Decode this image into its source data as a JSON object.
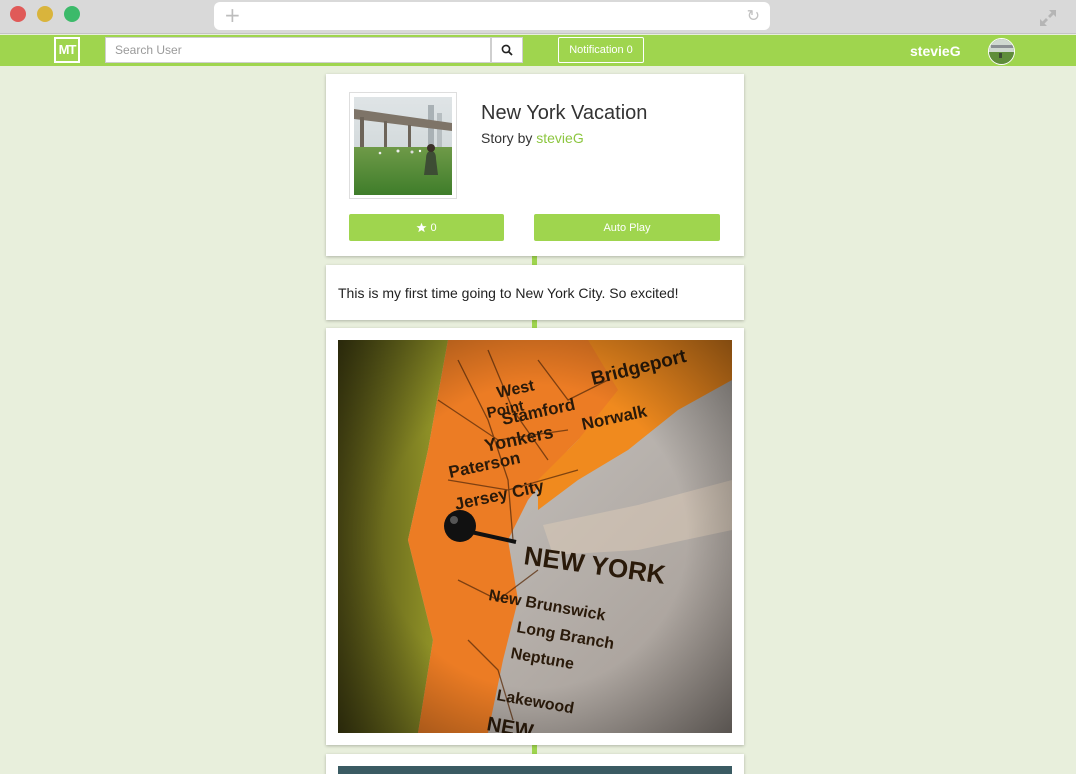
{
  "browser": {
    "window_controls": [
      "close",
      "minimize",
      "zoom"
    ],
    "new_tab_icon": "plus-icon",
    "reload_icon": "reload-icon",
    "fullscreen_icon": "expand-icon"
  },
  "navbar": {
    "logo_text": "MT",
    "search_placeholder": "Search User",
    "search_icon": "search-icon",
    "notification_label": "Notification 0",
    "username": "stevieG"
  },
  "story": {
    "title": "New York Vacation",
    "by_label": "Story by",
    "author": "stevieG",
    "star_count": "0",
    "star_icon": "star-icon",
    "autoplay_label": "Auto Play"
  },
  "entries": [
    {
      "type": "text",
      "text": "This is my first time going to New York City. So excited!"
    },
    {
      "type": "image",
      "map_labels": [
        "Stamford",
        "Norwalk",
        "Bridgeport",
        "Yonkers",
        "Paterson",
        "Jersey City",
        "NEW YORK",
        "New Brunswick",
        "Long Branch",
        "Neptune",
        "Lakewood",
        "West Point",
        "NEW"
      ]
    },
    {
      "type": "image"
    }
  ],
  "colors": {
    "accent": "#9fd54e",
    "background": "#e8efdc",
    "author_link": "#8cc63f"
  }
}
